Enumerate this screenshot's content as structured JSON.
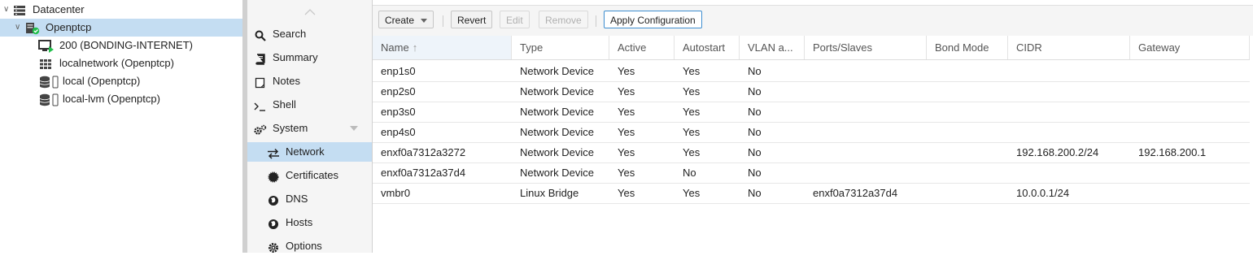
{
  "tree": {
    "datacenter": "Datacenter",
    "node": "Openptcp",
    "items": [
      {
        "label": "200 (BONDING-INTERNET)",
        "icon": "vm-running-icon"
      },
      {
        "label": "localnetwork (Openptcp)",
        "icon": "sdn-zone-icon"
      },
      {
        "label": "local (Openptcp)",
        "icon": "storage-icon"
      },
      {
        "label": "local-lvm (Openptcp)",
        "icon": "storage-icon"
      }
    ]
  },
  "nav": {
    "search": "Search",
    "summary": "Summary",
    "notes": "Notes",
    "shell": "Shell",
    "system": "System",
    "network": "Network",
    "certificates": "Certificates",
    "dns": "DNS",
    "hosts": "Hosts",
    "options": "Options"
  },
  "toolbar": {
    "create": "Create",
    "revert": "Revert",
    "edit": "Edit",
    "remove": "Remove",
    "apply": "Apply Configuration"
  },
  "columns": [
    "Name",
    "Type",
    "Active",
    "Autostart",
    "VLAN a...",
    "Ports/Slaves",
    "Bond Mode",
    "CIDR",
    "Gateway"
  ],
  "rows": [
    [
      "enp1s0",
      "Network Device",
      "Yes",
      "Yes",
      "No",
      "",
      "",
      "",
      ""
    ],
    [
      "enp2s0",
      "Network Device",
      "Yes",
      "Yes",
      "No",
      "",
      "",
      "",
      ""
    ],
    [
      "enp3s0",
      "Network Device",
      "Yes",
      "Yes",
      "No",
      "",
      "",
      "",
      ""
    ],
    [
      "enp4s0",
      "Network Device",
      "Yes",
      "Yes",
      "No",
      "",
      "",
      "",
      ""
    ],
    [
      "enxf0a7312a3272",
      "Network Device",
      "Yes",
      "Yes",
      "No",
      "",
      "",
      "192.168.200.2/24",
      "192.168.200.1"
    ],
    [
      "enxf0a7312a37d4",
      "Network Device",
      "Yes",
      "No",
      "No",
      "",
      "",
      "",
      ""
    ],
    [
      "vmbr0",
      "Linux Bridge",
      "Yes",
      "Yes",
      "No",
      "enxf0a7312a37d4",
      "",
      "10.0.0.1/24",
      ""
    ]
  ],
  "colors": {
    "selection": "#c4ddf2",
    "primary_border": "#3e8ed0",
    "running": "#21bf4b"
  }
}
